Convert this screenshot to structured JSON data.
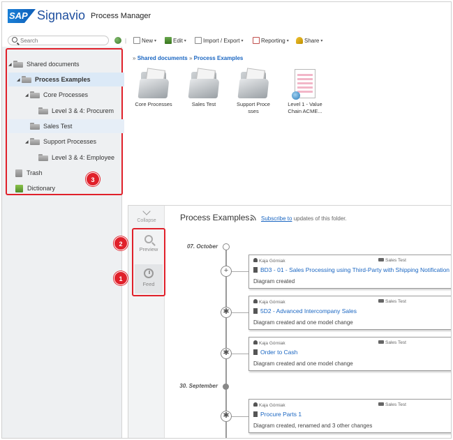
{
  "header": {
    "logo_text": "SAP",
    "brand": "Signavio",
    "app_title": "Process Manager"
  },
  "toolbar": {
    "search_placeholder": "Search",
    "new_label": "New",
    "edit_label": "Edit",
    "import_export_label": "Import / Export",
    "reporting_label": "Reporting",
    "share_label": "Share"
  },
  "sidebar": {
    "items": [
      {
        "label": "Shared documents",
        "icon": "folder-icon"
      },
      {
        "label": "Process Examples",
        "icon": "folder-icon"
      },
      {
        "label": "Core Processes",
        "icon": "folder-icon"
      },
      {
        "label": "Level 3 & 4: Procurem",
        "icon": "folder-icon"
      },
      {
        "label": "Sales Test",
        "icon": "folder-icon"
      },
      {
        "label": "Support Processes",
        "icon": "folder-icon"
      },
      {
        "label": "Level 3 & 4: Employee",
        "icon": "folder-icon"
      },
      {
        "label": "Trash",
        "icon": "trash-icon"
      },
      {
        "label": "Dictionary",
        "icon": "dictionary-icon"
      }
    ]
  },
  "breadcrumb": {
    "prefix": "»",
    "root": "Shared documents",
    "sep": "»",
    "current": "Process Examples"
  },
  "tiles": [
    {
      "label": "Core Processes"
    },
    {
      "label": "Sales Test"
    },
    {
      "label": "Support Proce sses"
    },
    {
      "label": "Level 1 - Value Chain ACME..."
    }
  ],
  "feed_panel": {
    "collapse_label": "Collapse",
    "preview_label": "Preview",
    "feed_label": "Feed",
    "title": "Process Examples",
    "subscribe_link": "Subscribe to",
    "subscribe_rest": "updates of this folder."
  },
  "timeline": {
    "dates": [
      "07. October",
      "30. September"
    ],
    "entries": [
      {
        "author": "Kaja Górniak",
        "folder": "Sales Test",
        "title": "BD3 - 01 - Sales Processing using Third-Party with Shipping Notification",
        "desc": "Diagram created"
      },
      {
        "author": "Kaja Górniak",
        "folder": "Sales Test",
        "title": "5D2 - Advanced Intercompany Sales",
        "desc": "Diagram created and one model change"
      },
      {
        "author": "Kaja Górniak",
        "folder": "Sales Test",
        "title": "Order to Cash",
        "desc": "Diagram created and one model change"
      },
      {
        "author": "Kaja Górniak",
        "folder": "Sales Test",
        "title": "Procure Parts 1",
        "desc": "Diagram created, renamed and 3 other changes"
      }
    ]
  },
  "annotations": {
    "badge1": "1",
    "badge2": "2",
    "badge3": "3",
    "highlight_color": "#e0202a"
  }
}
